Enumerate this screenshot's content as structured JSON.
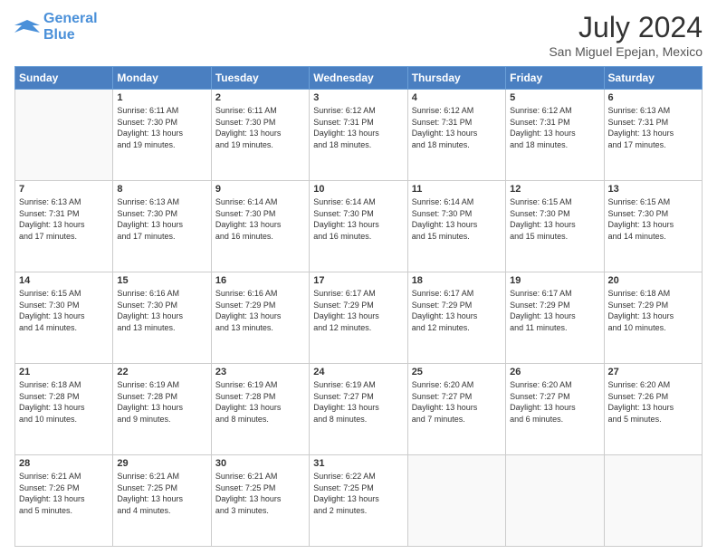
{
  "logo": {
    "line1": "General",
    "line2": "Blue"
  },
  "title": "July 2024",
  "subtitle": "San Miguel Epejan, Mexico",
  "days_header": [
    "Sunday",
    "Monday",
    "Tuesday",
    "Wednesday",
    "Thursday",
    "Friday",
    "Saturday"
  ],
  "weeks": [
    [
      {
        "num": "",
        "info": ""
      },
      {
        "num": "1",
        "info": "Sunrise: 6:11 AM\nSunset: 7:30 PM\nDaylight: 13 hours\nand 19 minutes."
      },
      {
        "num": "2",
        "info": "Sunrise: 6:11 AM\nSunset: 7:30 PM\nDaylight: 13 hours\nand 19 minutes."
      },
      {
        "num": "3",
        "info": "Sunrise: 6:12 AM\nSunset: 7:31 PM\nDaylight: 13 hours\nand 18 minutes."
      },
      {
        "num": "4",
        "info": "Sunrise: 6:12 AM\nSunset: 7:31 PM\nDaylight: 13 hours\nand 18 minutes."
      },
      {
        "num": "5",
        "info": "Sunrise: 6:12 AM\nSunset: 7:31 PM\nDaylight: 13 hours\nand 18 minutes."
      },
      {
        "num": "6",
        "info": "Sunrise: 6:13 AM\nSunset: 7:31 PM\nDaylight: 13 hours\nand 17 minutes."
      }
    ],
    [
      {
        "num": "7",
        "info": "Sunrise: 6:13 AM\nSunset: 7:31 PM\nDaylight: 13 hours\nand 17 minutes."
      },
      {
        "num": "8",
        "info": "Sunrise: 6:13 AM\nSunset: 7:30 PM\nDaylight: 13 hours\nand 17 minutes."
      },
      {
        "num": "9",
        "info": "Sunrise: 6:14 AM\nSunset: 7:30 PM\nDaylight: 13 hours\nand 16 minutes."
      },
      {
        "num": "10",
        "info": "Sunrise: 6:14 AM\nSunset: 7:30 PM\nDaylight: 13 hours\nand 16 minutes."
      },
      {
        "num": "11",
        "info": "Sunrise: 6:14 AM\nSunset: 7:30 PM\nDaylight: 13 hours\nand 15 minutes."
      },
      {
        "num": "12",
        "info": "Sunrise: 6:15 AM\nSunset: 7:30 PM\nDaylight: 13 hours\nand 15 minutes."
      },
      {
        "num": "13",
        "info": "Sunrise: 6:15 AM\nSunset: 7:30 PM\nDaylight: 13 hours\nand 14 minutes."
      }
    ],
    [
      {
        "num": "14",
        "info": "Sunrise: 6:15 AM\nSunset: 7:30 PM\nDaylight: 13 hours\nand 14 minutes."
      },
      {
        "num": "15",
        "info": "Sunrise: 6:16 AM\nSunset: 7:30 PM\nDaylight: 13 hours\nand 13 minutes."
      },
      {
        "num": "16",
        "info": "Sunrise: 6:16 AM\nSunset: 7:29 PM\nDaylight: 13 hours\nand 13 minutes."
      },
      {
        "num": "17",
        "info": "Sunrise: 6:17 AM\nSunset: 7:29 PM\nDaylight: 13 hours\nand 12 minutes."
      },
      {
        "num": "18",
        "info": "Sunrise: 6:17 AM\nSunset: 7:29 PM\nDaylight: 13 hours\nand 12 minutes."
      },
      {
        "num": "19",
        "info": "Sunrise: 6:17 AM\nSunset: 7:29 PM\nDaylight: 13 hours\nand 11 minutes."
      },
      {
        "num": "20",
        "info": "Sunrise: 6:18 AM\nSunset: 7:29 PM\nDaylight: 13 hours\nand 10 minutes."
      }
    ],
    [
      {
        "num": "21",
        "info": "Sunrise: 6:18 AM\nSunset: 7:28 PM\nDaylight: 13 hours\nand 10 minutes."
      },
      {
        "num": "22",
        "info": "Sunrise: 6:19 AM\nSunset: 7:28 PM\nDaylight: 13 hours\nand 9 minutes."
      },
      {
        "num": "23",
        "info": "Sunrise: 6:19 AM\nSunset: 7:28 PM\nDaylight: 13 hours\nand 8 minutes."
      },
      {
        "num": "24",
        "info": "Sunrise: 6:19 AM\nSunset: 7:27 PM\nDaylight: 13 hours\nand 8 minutes."
      },
      {
        "num": "25",
        "info": "Sunrise: 6:20 AM\nSunset: 7:27 PM\nDaylight: 13 hours\nand 7 minutes."
      },
      {
        "num": "26",
        "info": "Sunrise: 6:20 AM\nSunset: 7:27 PM\nDaylight: 13 hours\nand 6 minutes."
      },
      {
        "num": "27",
        "info": "Sunrise: 6:20 AM\nSunset: 7:26 PM\nDaylight: 13 hours\nand 5 minutes."
      }
    ],
    [
      {
        "num": "28",
        "info": "Sunrise: 6:21 AM\nSunset: 7:26 PM\nDaylight: 13 hours\nand 5 minutes."
      },
      {
        "num": "29",
        "info": "Sunrise: 6:21 AM\nSunset: 7:25 PM\nDaylight: 13 hours\nand 4 minutes."
      },
      {
        "num": "30",
        "info": "Sunrise: 6:21 AM\nSunset: 7:25 PM\nDaylight: 13 hours\nand 3 minutes."
      },
      {
        "num": "31",
        "info": "Sunrise: 6:22 AM\nSunset: 7:25 PM\nDaylight: 13 hours\nand 2 minutes."
      },
      {
        "num": "",
        "info": ""
      },
      {
        "num": "",
        "info": ""
      },
      {
        "num": "",
        "info": ""
      }
    ]
  ]
}
